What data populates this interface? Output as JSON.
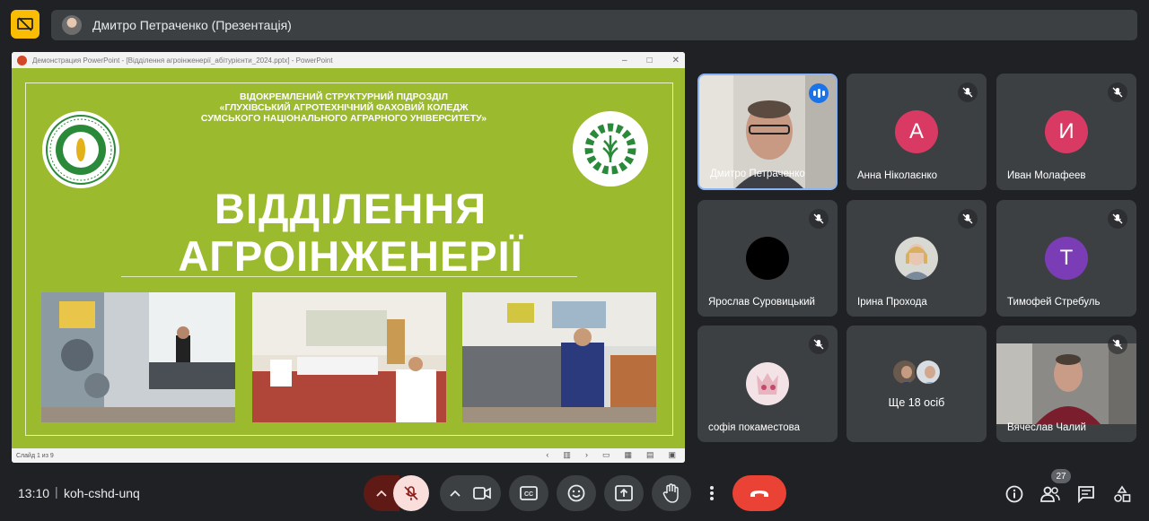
{
  "topbar": {
    "presenter_name": "Дмитро Петраченко (Презентація)"
  },
  "presentation": {
    "window_title": "Демонстрация PowerPoint - [Відділення агроінженерії_абітурієнти_2024.pptx] - PowerPoint",
    "slide_header": [
      "ВІДОКРЕМЛЕНИЙ СТРУКТУРНИЙ ПІДРОЗДІЛ",
      "«ГЛУХІВСЬКИЙ АГРОТЕХНІЧНИЙ ФАХОВИЙ КОЛЕДЖ",
      "СУМСЬКОГО НАЦІОНАЛЬНОГО АГРАРНОГО УНІВЕРСИТЕТУ»"
    ],
    "slide_title": [
      "ВІДДІЛЕННЯ",
      "АГРОІНЖЕНЕРІЇ"
    ],
    "status_text": "Слайд 1 из 9",
    "colors": {
      "slide_bg": "#9bba2e"
    }
  },
  "participants": [
    {
      "name": "Дмитро Петраченко",
      "type": "video",
      "speaking": true
    },
    {
      "name": "Анна Ніколаєнко",
      "letter": "А",
      "avatar_color": "#d93a63",
      "mic_off": true
    },
    {
      "name": "Иван Молафеев",
      "letter": "И",
      "avatar_color": "#d93a63",
      "mic_off": true
    },
    {
      "name": "Ярослав Суровицький",
      "type": "black-avatar",
      "mic_off": true
    },
    {
      "name": "Ірина Прохода",
      "type": "photo-avatar",
      "mic_off": true
    },
    {
      "name": "Тимофей Стребуль",
      "letter": "Т",
      "avatar_color": "#7b3db5",
      "mic_off": true
    },
    {
      "name": "софія покаместова",
      "type": "photo-avatar",
      "mic_off": true
    },
    {
      "name": "",
      "type": "more"
    },
    {
      "name": "Вячеслав Чалий",
      "type": "video",
      "mic_off": true
    }
  ],
  "more_people_label": "Ще 18 осіб",
  "bottombar": {
    "time": "13:10",
    "separator": "|",
    "meeting_code": "koh-cshd-unq",
    "participants_count": "27"
  },
  "icons": [
    "present-to-all-icon",
    "mic-off-icon",
    "chevron-up-icon",
    "camera-icon",
    "captions-icon",
    "emoji-icon",
    "present-icon",
    "hand-icon",
    "more-vert-icon",
    "call-end-icon",
    "info-icon",
    "people-icon",
    "chat-icon",
    "activities-icon"
  ]
}
